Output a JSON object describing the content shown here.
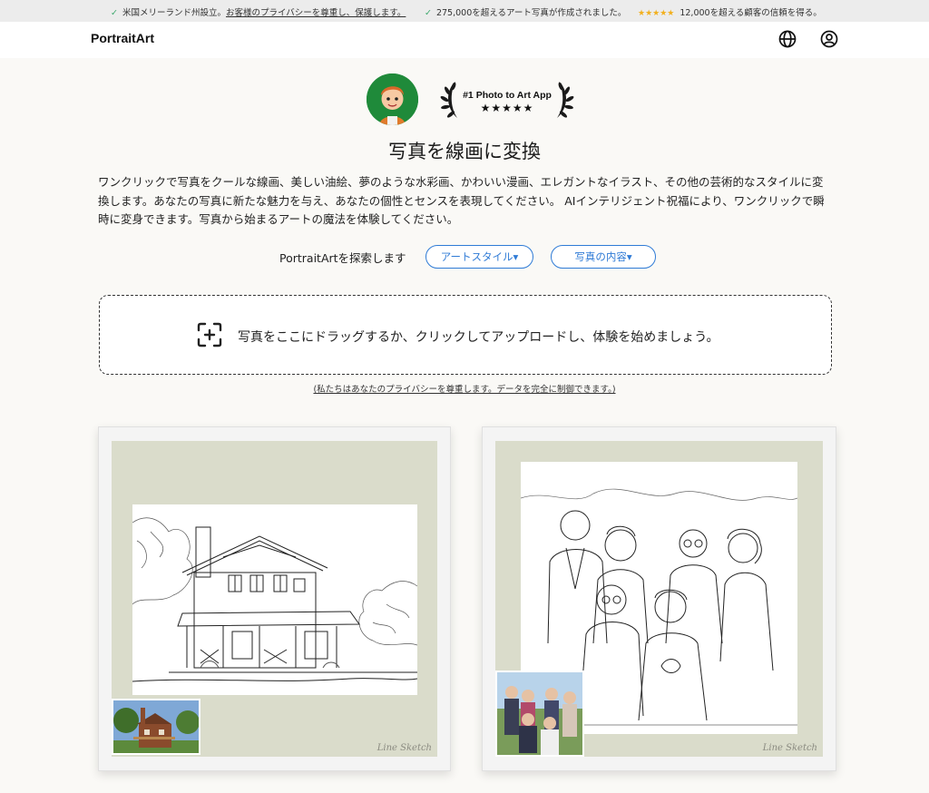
{
  "topbar": {
    "item1": "米国メリーランド州設立。",
    "item1_link": "お客様のプライバシーを尊重し、保護します。",
    "item2": "275,000を超えるアート写真が作成されました。",
    "item3_stars": "★★★★★",
    "item3": "12,000を超える顧客の信頼を得る。",
    "check": "✓"
  },
  "header": {
    "logo": "PortraitArt",
    "globe_icon": "globe-icon",
    "user_icon": "user-circle-icon"
  },
  "hero": {
    "award_title": "#1 Photo to Art App",
    "award_stars": "★★★★★",
    "title": "写真を線画に変換",
    "description": "ワンクリックで写真をクールな線画、美しい油絵、夢のような水彩画、かわいい漫画、エレガントなイラスト、その他の芸術的なスタイルに変換します。あなたの写真に新たな魅力を与え、あなたの個性とセンスを表現してください。 AIインテリジェント祝福により、ワンクリックで瞬時に変身できます。写真から始まるアートの魔法を体験してください。"
  },
  "explore": {
    "label": "PortraitArtを探索します",
    "art_style": "アートスタイル▾",
    "photo_content": "写真の内容▾"
  },
  "upload": {
    "text": "写真をここにドラッグするか、クリックしてアップロードし、体験を始めましょう。",
    "icon": "add-image-icon",
    "privacy": "(私たちはあなたのプライバシーを尊重します。データを完全に制御できます。)"
  },
  "gallery": [
    {
      "style": "Line Sketch",
      "subject": "house"
    },
    {
      "style": "Line Sketch",
      "subject": "family"
    }
  ],
  "colors": {
    "accent": "#2f7bd6",
    "mat": "#dadccb",
    "check": "#3aa86b",
    "stars": "#f2b01e"
  }
}
